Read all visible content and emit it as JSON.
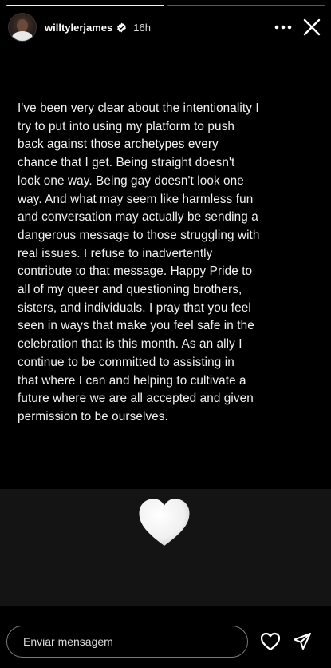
{
  "header": {
    "username": "willtylerjames",
    "time": "16h",
    "verified": true
  },
  "story": {
    "text": "I've been very clear about the intentionality I\ntry to put into using my platform to push\nback against those archetypes every\nchance that I get. Being straight doesn't\nlook one way. Being gay doesn't look one\nway. And what may seem like harmless fun\nand conversation may actually be sending a\ndangerous message to those struggling with\nreal issues. I refuse to inadvertently\ncontribute to that message.  Happy Pride to\nall of my queer and questioning brothers,\nsisters, and individuals. I pray that you feel\nseen in ways that make you feel safe in the\ncelebration that is this month. As an ally I\ncontinue to be committed to assisting in\nthat where I can and helping to cultivate a\nfuture where we are all accepted and given\npermission to be ourselves.",
    "sticker": "white-heart-emoji"
  },
  "footer": {
    "message_placeholder": "Enviar mensagem",
    "message_value": ""
  },
  "colors": {
    "background": "#000000",
    "heart_band": "#141414",
    "text": "#f2f2f2",
    "input_border": "#7a7a7a",
    "verified_badge": "#ffffff"
  },
  "icons": {
    "more": "more-horizontal-icon",
    "close": "close-icon",
    "verified": "verified-badge-icon",
    "like": "heart-outline-icon",
    "send": "send-paper-plane-icon"
  }
}
